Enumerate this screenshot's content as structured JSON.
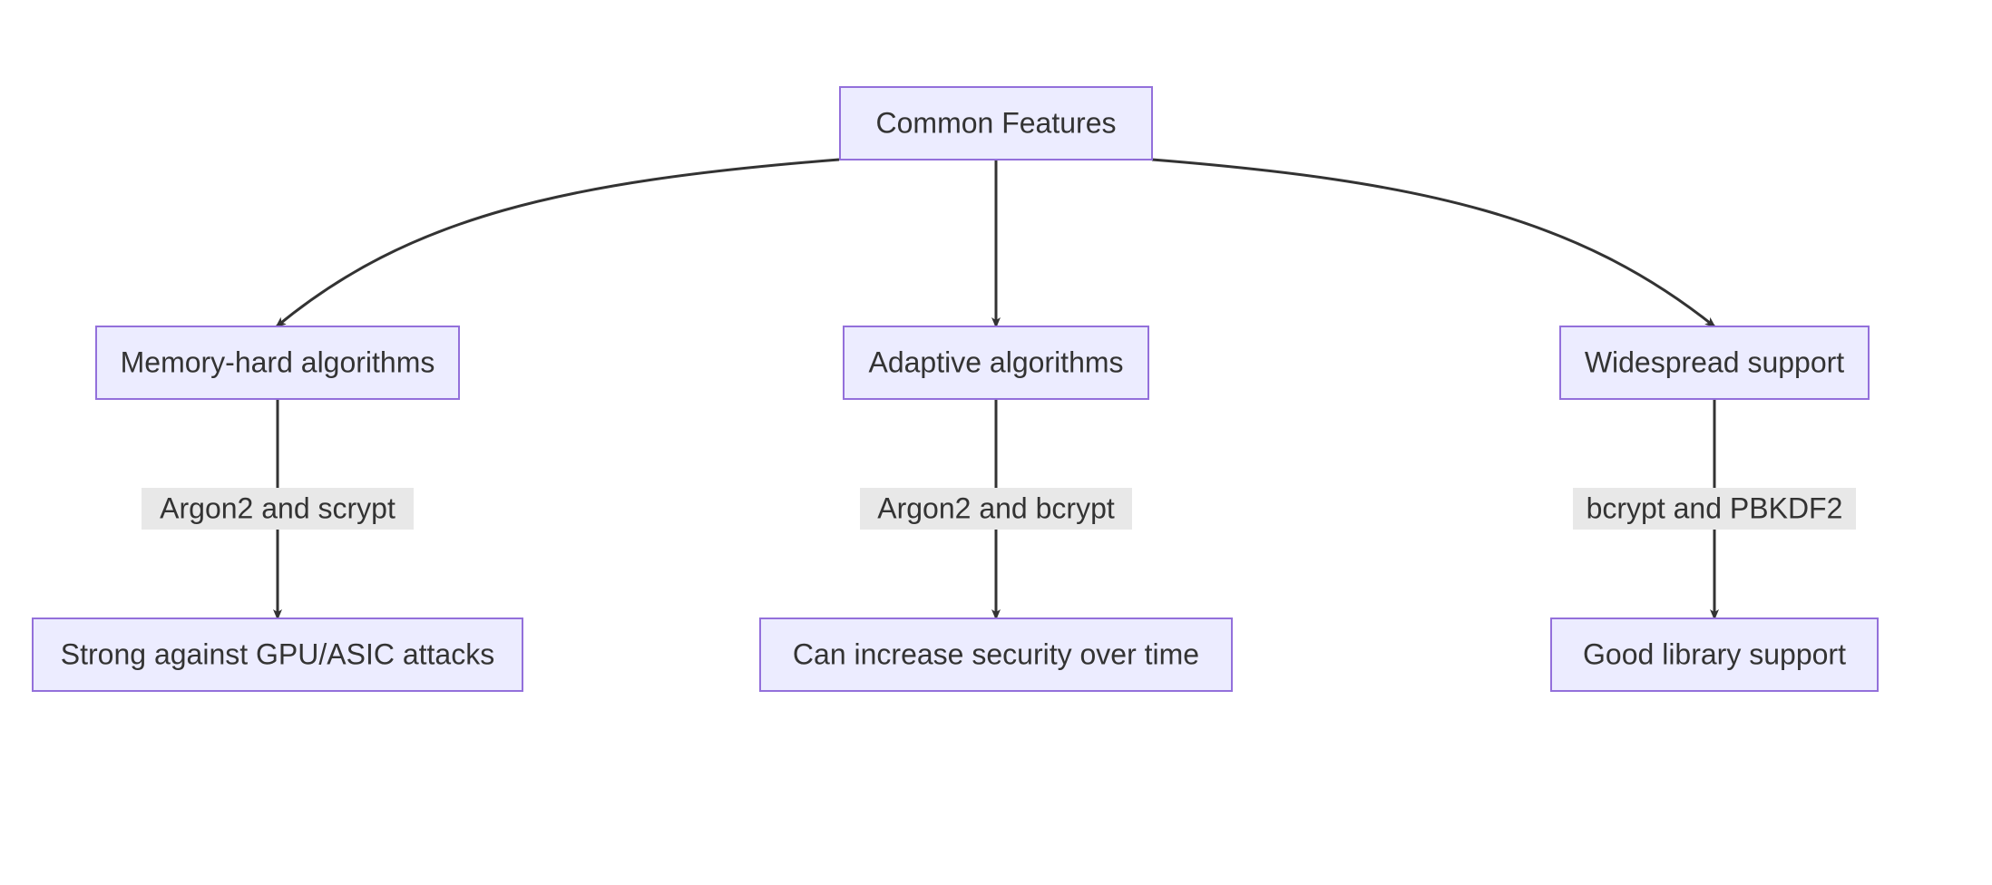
{
  "nodes": {
    "root": {
      "label": "Common Features"
    },
    "memory": {
      "label": "Memory-hard algorithms"
    },
    "adapt": {
      "label": "Adaptive algorithms"
    },
    "wide": {
      "label": "Widespread support"
    },
    "gpu": {
      "label": "Strong against GPU/ASIC attacks"
    },
    "secure": {
      "label": "Can increase security over time"
    },
    "lib": {
      "label": "Good library support"
    }
  },
  "edges": {
    "e1": {
      "label": "Argon2 and scrypt"
    },
    "e2": {
      "label": "Argon2 and bcrypt"
    },
    "e3": {
      "label": "bcrypt and PBKDF2"
    }
  }
}
